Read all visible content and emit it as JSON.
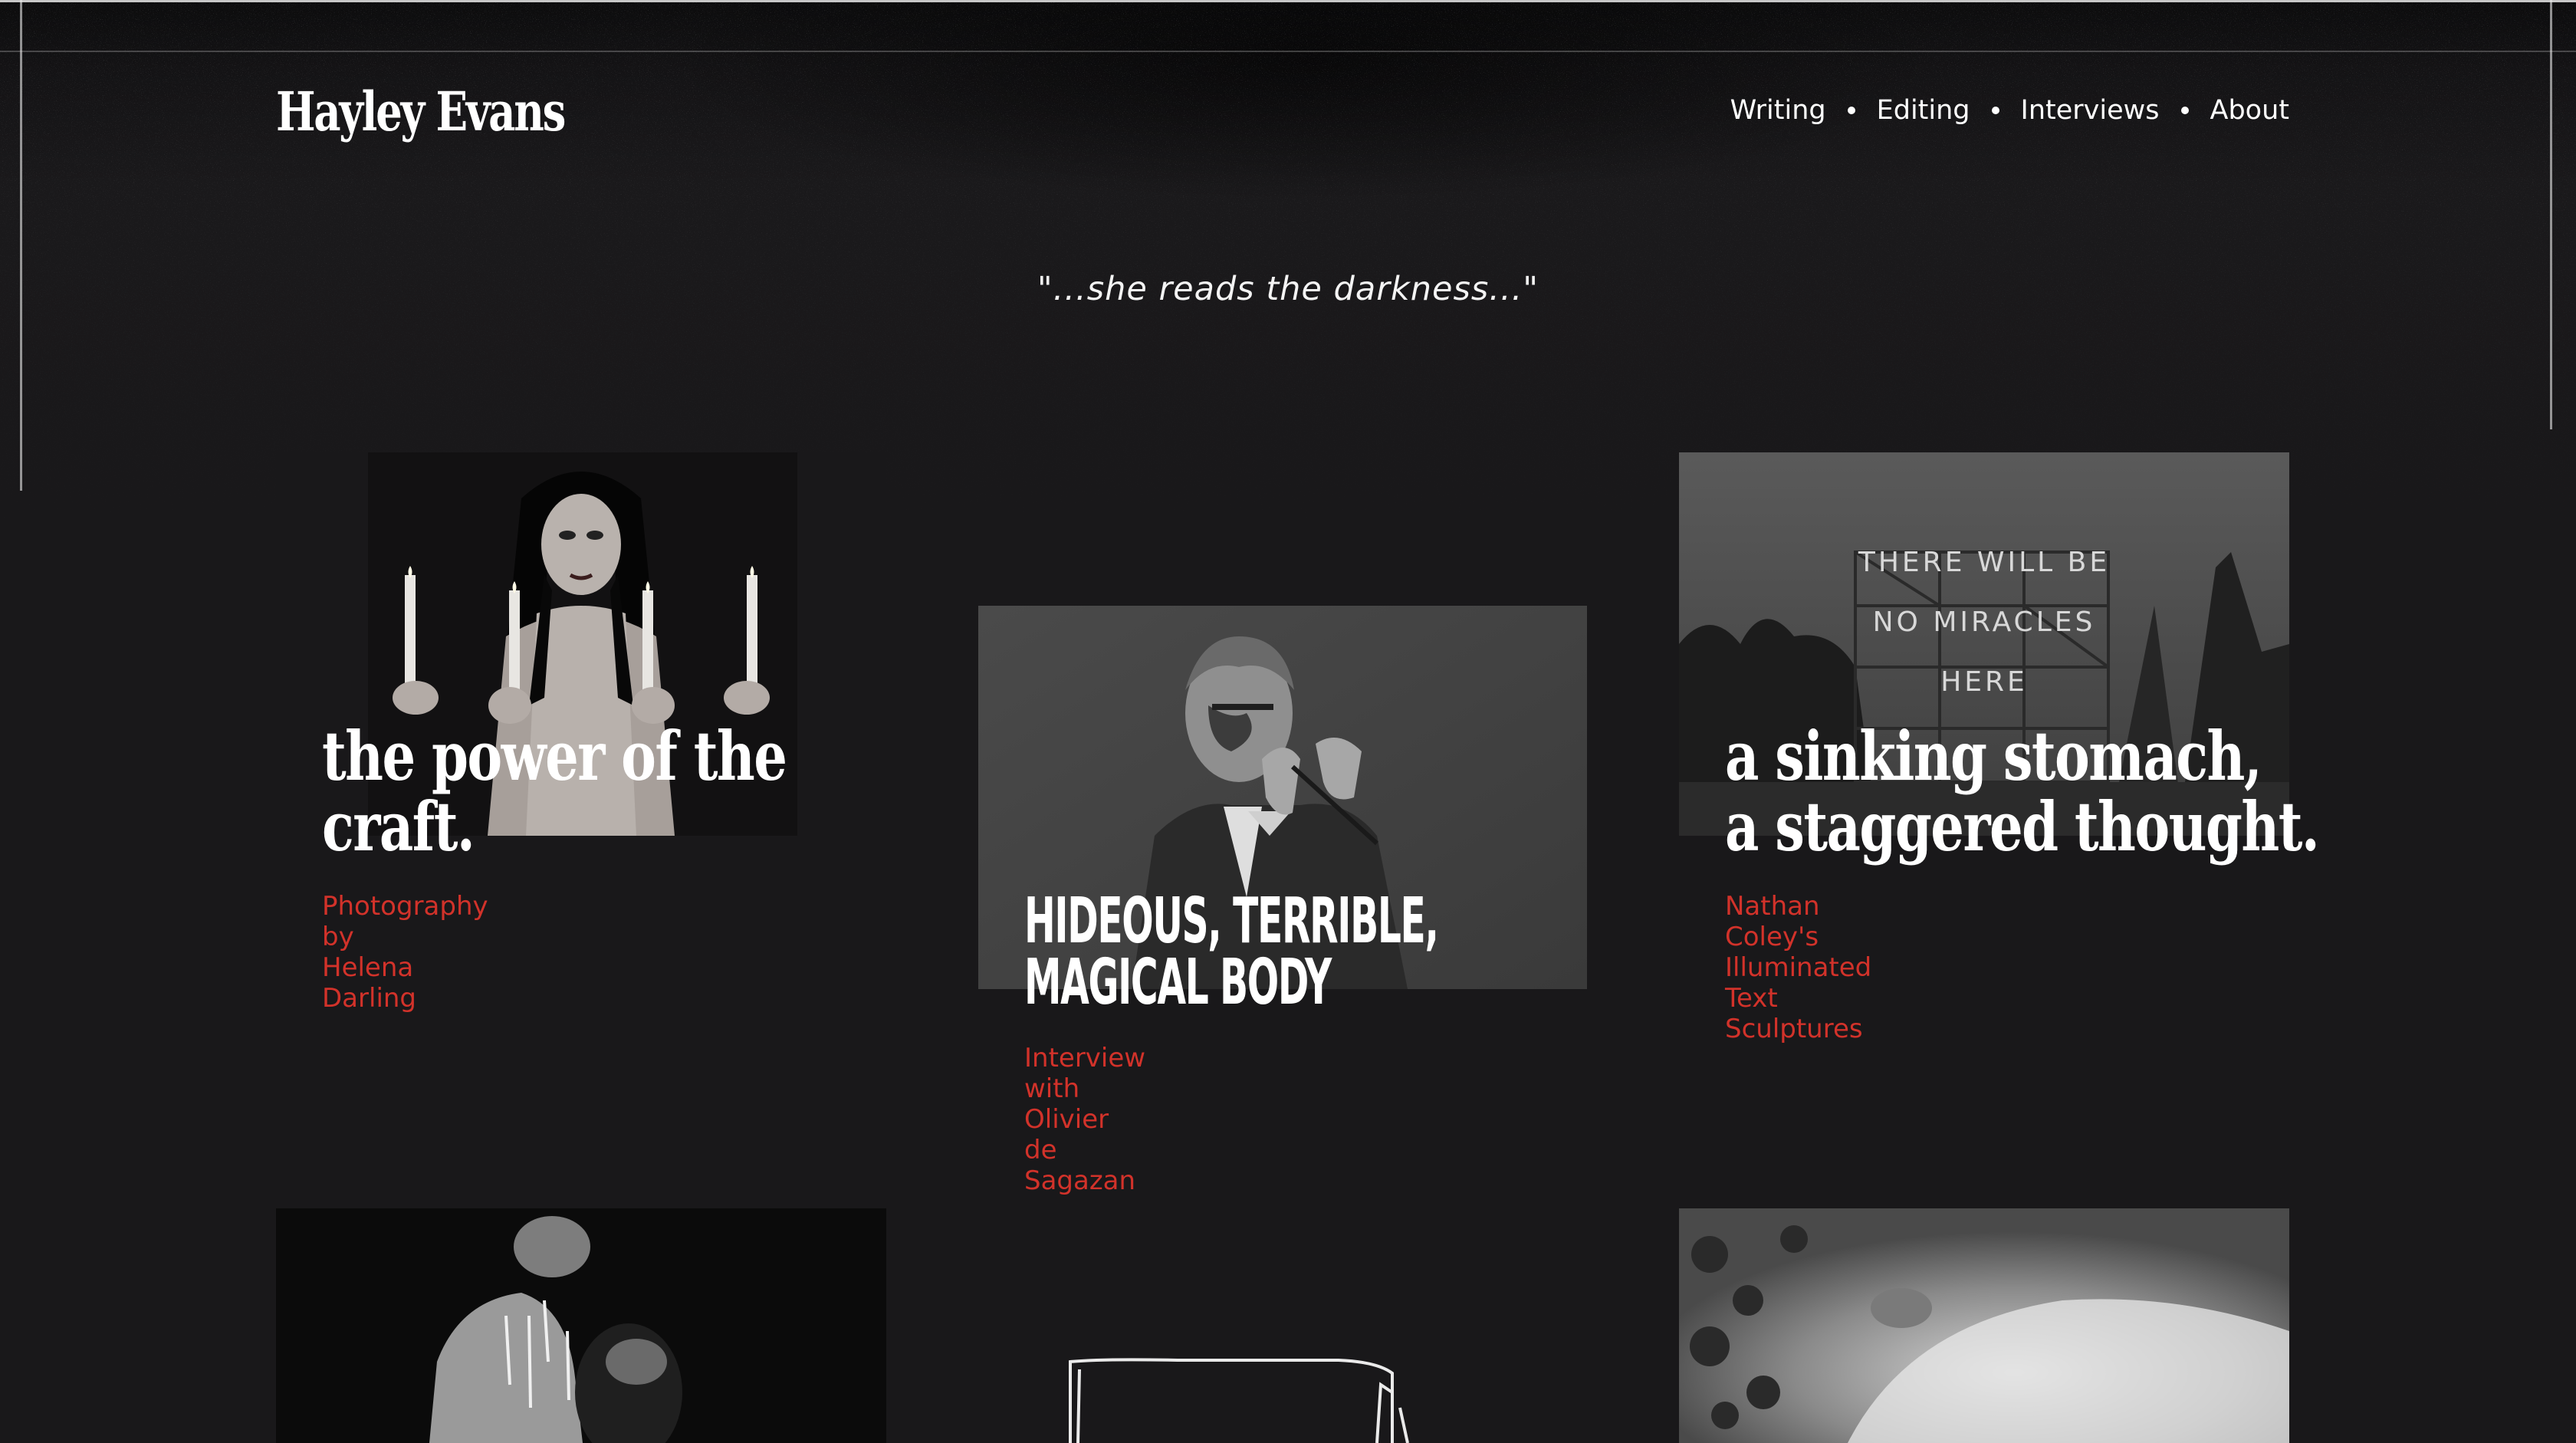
{
  "site": {
    "title": "Hayley Evans"
  },
  "nav": {
    "items": [
      {
        "label": "Writing"
      },
      {
        "label": "Editing"
      },
      {
        "label": "Interviews"
      },
      {
        "label": "About"
      }
    ]
  },
  "tagline": "\"...she reads the darkness...\"",
  "colors": {
    "background": "#19181a",
    "text": "#ffffff",
    "accent": "#d2322a"
  },
  "cards": [
    {
      "headline_lines": [
        "the power of the",
        "craft."
      ],
      "subtitle_lines": [
        "Photography by",
        "Helena Darling"
      ]
    },
    {
      "headline_lines": [
        "HIDEOUS, TERRIBLE,",
        "MAGICAL BODY"
      ],
      "subtitle_lines": [
        "Interview with Olivier",
        "de Sagazan"
      ]
    },
    {
      "headline_lines": [
        "a sinking stomach,",
        "a staggered thought."
      ],
      "subtitle_lines": [
        "Nathan Coley's",
        "Illuminated Text",
        "Sculptures"
      ],
      "image_text_lines": [
        "THERE WILL BE",
        "NO MIRACLES",
        "HERE"
      ]
    },
    {},
    {},
    {}
  ]
}
